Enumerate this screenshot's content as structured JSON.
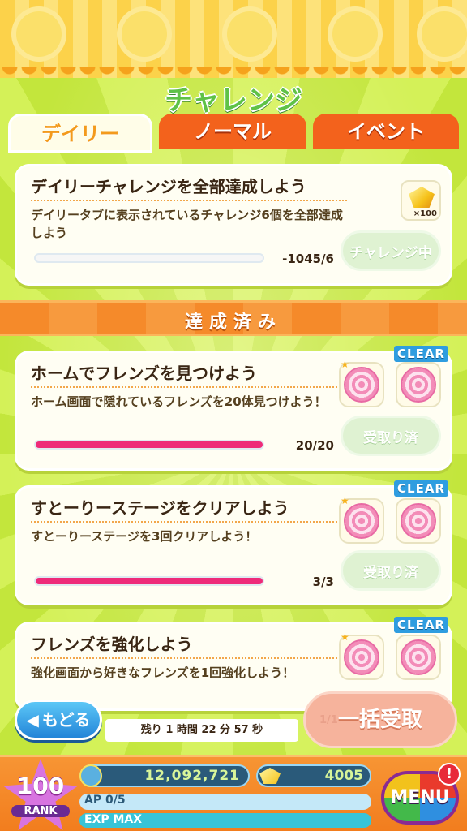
{
  "title": "チャレンジ",
  "tabs": {
    "daily": "デイリー",
    "normal": "ノーマル",
    "event": "イベント"
  },
  "daily_card": {
    "title": "デイリーチャレンジを全部達成しよう",
    "desc": "デイリータブに表示されているチャレンジ6個を全部達成しよう",
    "progress_text": "-1045/6",
    "progress_fraction": 0,
    "button": "チャレンジ中",
    "reward_qty": "×100"
  },
  "achieved_header": "達成済み",
  "challenges": [
    {
      "title": "ホームでフレンズを見つけよう",
      "desc": "ホーム画面で隠れているフレンズを20体見つけよう！",
      "progress_text": "20/20",
      "progress_fraction": 1,
      "badge": "CLEAR",
      "button": "受取り済"
    },
    {
      "title": "すとーりーステージをクリアしよう",
      "desc": "すとーりーステージを3回クリアしよう！",
      "progress_text": "3/3",
      "progress_fraction": 1,
      "badge": "CLEAR",
      "button": "受取り済"
    },
    {
      "title": "フレンズを強化しよう",
      "desc": "強化画面から好きなフレンズを1回強化しよう！",
      "badge": "CLEAR"
    }
  ],
  "bottom": {
    "back": "もどる",
    "timer": "残り 1 時間 22 分 57 秒",
    "bulk_label": "一括受取",
    "bulk_count": "1/1"
  },
  "status": {
    "rank": "100",
    "rank_label": "RANK",
    "coins": "12,092,721",
    "gems": "4005",
    "ap": "AP 0/5",
    "exp": "EXP MAX",
    "menu": "MENU",
    "alert": "!"
  },
  "colors": {
    "accent_orange": "#f3621c",
    "progress_pink": "#ee2b79",
    "clear_blue": "#2f9de0",
    "bg_green": "#c9ec4a"
  }
}
